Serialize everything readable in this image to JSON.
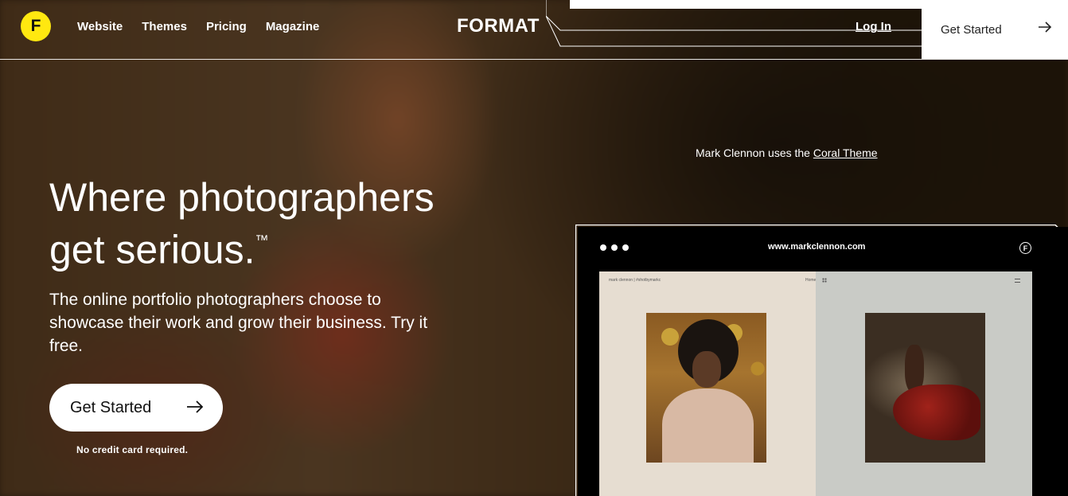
{
  "brand": {
    "badge_letter": "F",
    "wordmark": "FORMAT",
    "badge_color": "#ffe810"
  },
  "nav": {
    "items": [
      "Website",
      "Themes",
      "Pricing",
      "Magazine"
    ]
  },
  "header": {
    "login_label": "Log In",
    "cta_label": "Get Started"
  },
  "hero": {
    "headline_line1": "Where photographers",
    "headline_line2": "get serious.",
    "trademark": "™",
    "subtext": "The online portfolio photographers choose to showcase their work and grow their business. Try it free.",
    "cta_label": "Get Started",
    "note": "No credit card required."
  },
  "credit": {
    "prefix": "Mark Clennon uses the ",
    "theme_link": "Coral Theme"
  },
  "mock": {
    "url": "www.markclennon.com",
    "logo_letter": "F",
    "site_name": "mark clennon | #shotbymarkc",
    "home_label": "Home"
  },
  "icons": [
    "right-arrow-icon",
    "grid-icon",
    "menu-icon"
  ]
}
